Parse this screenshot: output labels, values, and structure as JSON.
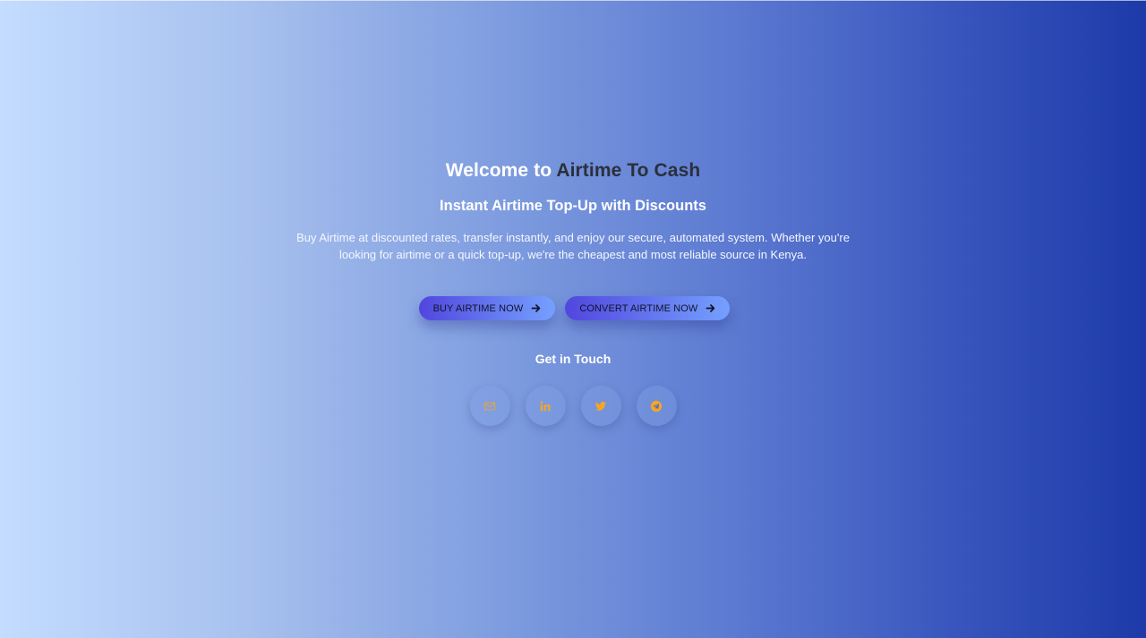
{
  "hero": {
    "title_prefix": "Welcome to",
    "title_accent": "Airtime To Cash",
    "subtitle": "Instant Airtime Top-Up with Discounts",
    "description": "Buy Airtime at discounted rates, transfer instantly, and enjoy our secure, automated system. Whether you're looking for airtime or a quick top-up, we're the cheapest and most reliable source in Kenya."
  },
  "buttons": {
    "buy_label": "BUY AIRTIME NOW",
    "convert_label": "CONVERT AIRTIME NOW"
  },
  "contact": {
    "title": "Get in Touch",
    "icons": [
      "mail-icon",
      "linkedin-icon",
      "twitter-icon",
      "telegram-icon"
    ],
    "icon_color": "#f5a623"
  },
  "colors": {
    "gradient_start": "#c3dcff",
    "gradient_end": "#1d3aa8",
    "title_accent": "#2a2f3a",
    "button_start": "#5146de",
    "button_end": "#75a0ff"
  }
}
